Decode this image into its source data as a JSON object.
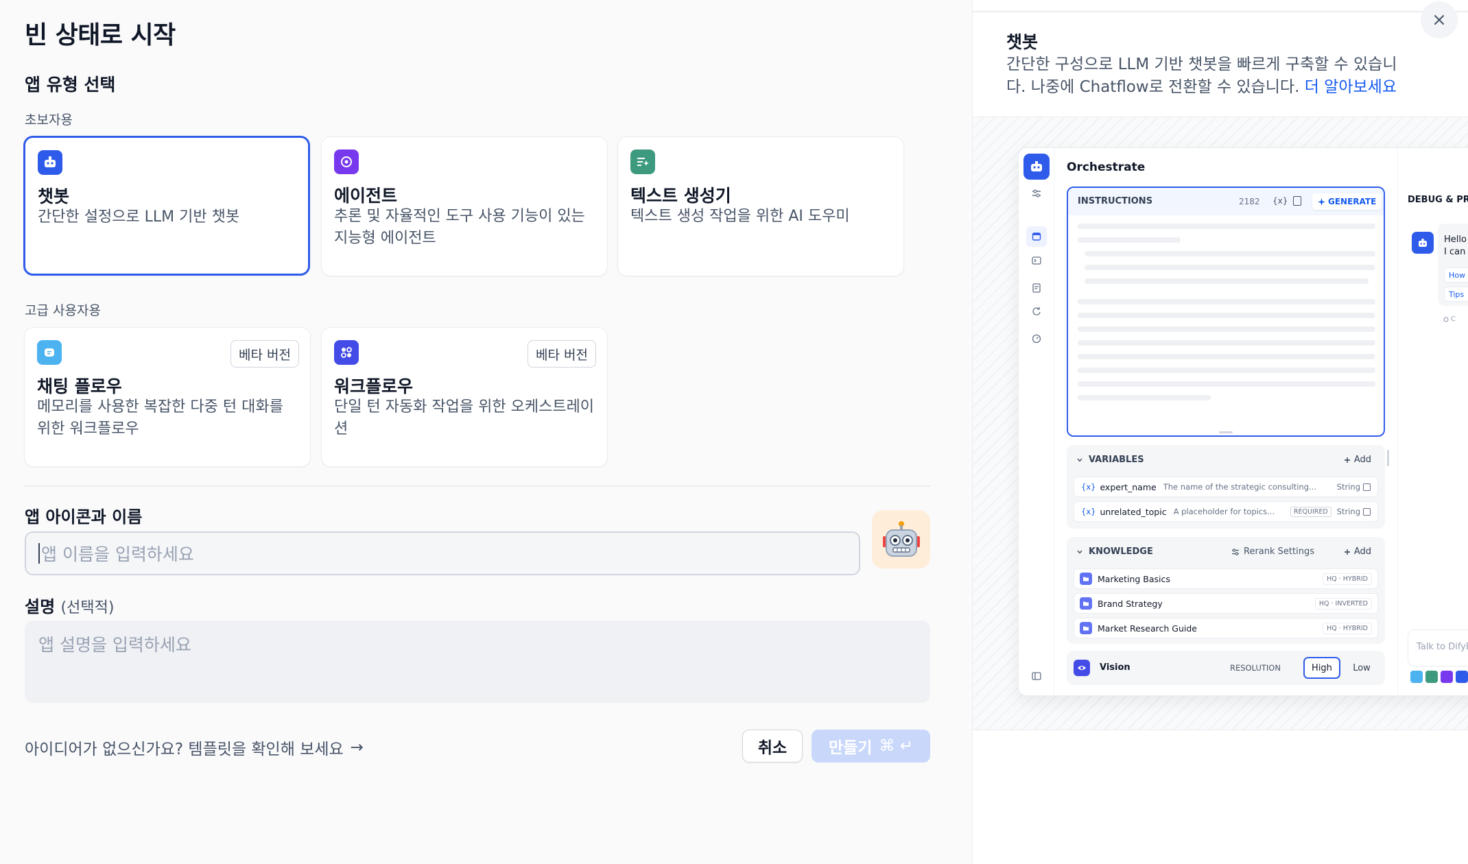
{
  "page": {
    "title": "빈 상태로 시작",
    "app_type_heading": "앱 유형 선택",
    "beginner_label": "초보자용",
    "advanced_label": "고급 사용자용"
  },
  "app_types": {
    "chatbot": {
      "title": "챗봇",
      "desc": "간단한 설정으로 LLM 기반 챗봇"
    },
    "agent": {
      "title": "에이전트",
      "desc": "추론 및 자율적인 도구 사용 기능이 있는 지능형 에이전트"
    },
    "textgen": {
      "title": "텍스트 생성기",
      "desc": "텍스트 생성 작업을 위한 AI 도우미"
    },
    "chatflow": {
      "title": "채팅 플로우",
      "desc": "메모리를 사용한 복잡한 다중 턴 대화를 위한 워크플로우",
      "badge": "베타 버전"
    },
    "workflow": {
      "title": "워크플로우",
      "desc": "단일 턴 자동화 작업을 위한 오케스트레이션",
      "badge": "베타 버전"
    }
  },
  "form": {
    "name_heading": "앱 아이콘과 이름",
    "name_placeholder": "앱 이름을 입력하세요",
    "desc_heading": "설명",
    "desc_optional": "(선택적)",
    "desc_placeholder": "앱 설명을 입력하세요",
    "template_link": "아이디어가 없으신가요? 템플릿을 확인해 보세요",
    "template_arrow": "→",
    "cancel": "취소",
    "create": "만들기",
    "create_shortcut": "⌘ ↵"
  },
  "preview": {
    "title": "챗봇",
    "desc": "간단한 구성으로 LLM 기반 챗봇을 빠르게 구축할 수 있습니다. 나중에 Chatflow로 전환할 수 있습니다.",
    "learn_more": "더 알아보세요",
    "orchestrate": "Orchestrate",
    "instructions": "INSTRUCTIONS",
    "char_count": "2182",
    "var_symbol": "{x}",
    "generate": "GENERATE",
    "variables_label": "VARIABLES",
    "add": "Add",
    "variables": [
      {
        "tag": "{x}",
        "name": "expert_name",
        "desc": "The name of the strategic consulting...",
        "required": "",
        "type": "String"
      },
      {
        "tag": "{x}",
        "name": "unrelated_topic",
        "desc": "A placeholder for topics...",
        "required": "REQUIRED",
        "type": "String"
      }
    ],
    "knowledge_label": "KNOWLEDGE",
    "rerank": "Rerank Settings",
    "knowledge": [
      {
        "name": "Marketing Basics",
        "badge": "HQ · HYBRID"
      },
      {
        "name": "Brand Strategy",
        "badge": "HQ · INVERTED"
      },
      {
        "name": "Market Research Guide",
        "badge": "HQ · HYBRID"
      }
    ],
    "vision": "Vision",
    "resolution": "RESOLUTION",
    "high": "High",
    "low": "Low",
    "debug_title": "DEBUG & PRE",
    "chat_line1": "Hello",
    "chat_line2": "I can",
    "chat_chip1": "How",
    "chat_chip2": "Tips",
    "chat_small": "C",
    "chat_placeholder": "Talk to DifyB"
  },
  "colors": {
    "accent": "#2f5bea",
    "chatbot_icon": "#2f5bea",
    "agent_icon": "#7839ee",
    "textgen_icon": "#3e9a7e",
    "chatflow_icon": "#4cb3f0",
    "workflow_icon": "#444ce7"
  }
}
